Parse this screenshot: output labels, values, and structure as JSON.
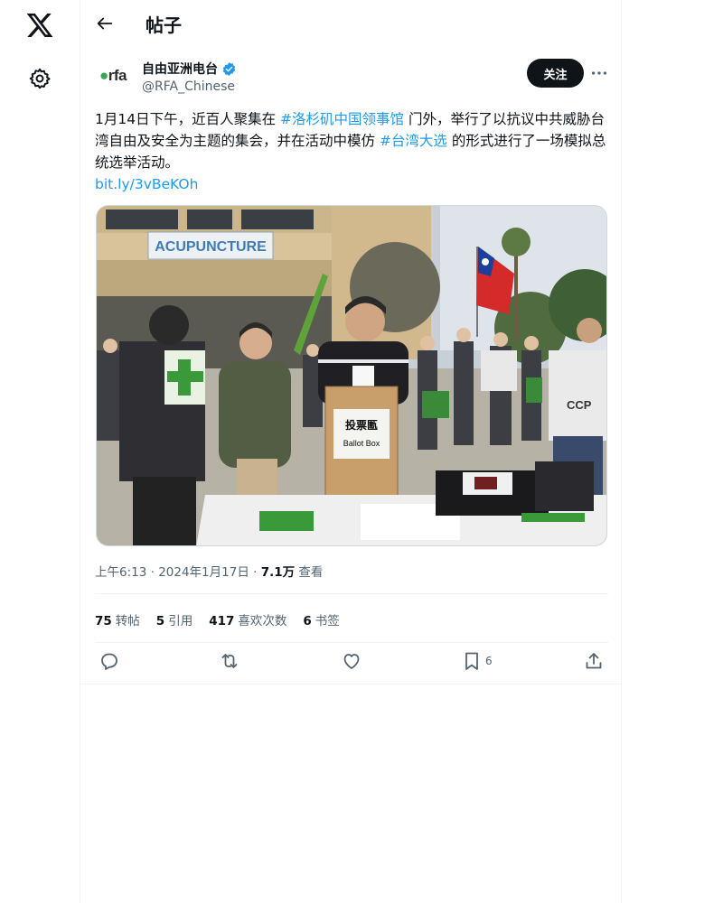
{
  "app": {
    "logo": "x-logo-icon",
    "settings_icon": "gear-icon"
  },
  "header": {
    "back_icon": "arrow-left-icon",
    "title": "帖子"
  },
  "author": {
    "avatar_logo": "rfa",
    "display_name": "自由亚洲电台",
    "verified_icon": "verified-badge-icon",
    "handle": "@RFA_Chinese",
    "follow_label": "关注",
    "more_icon": "more-horizontal-icon"
  },
  "tweet": {
    "text_parts": {
      "p1": "1月14日下午，近百人聚集在 ",
      "tag1": "#洛杉矶中国领事馆",
      "p2": " 门外，举行了以抗议中共威胁台湾自由及安全为主题的集会，并在活动中模仿 ",
      "tag2": "#台湾大选",
      "p3": " 的形式进行了一场模拟总统选举活动。"
    },
    "link": "bit.ly/3vBeKOh",
    "media": {
      "building_sign": "ACUPUNCTURE",
      "ballot_box_label_cn": "投票匭",
      "ballot_box_label_en": "Ballot Box",
      "shirt_text": "CCP"
    },
    "time": "上午6:13",
    "sep": " · ",
    "date": "2024年1月17日",
    "views_count": "7.1万",
    "views_label": " 查看"
  },
  "stats": [
    {
      "count": "75",
      "label": "转帖"
    },
    {
      "count": "5",
      "label": "引用"
    },
    {
      "count": "417",
      "label": "喜欢次数"
    },
    {
      "count": "6",
      "label": "书签"
    }
  ],
  "actions": {
    "reply_icon": "reply-icon",
    "retweet_icon": "retweet-icon",
    "like_icon": "heart-icon",
    "bookmark_icon": "bookmark-icon",
    "bookmark_count": "6",
    "share_icon": "share-icon"
  },
  "colors": {
    "accent": "#1d9bf0",
    "text": "#0f1419",
    "muted": "#536471",
    "border": "#eff3f4"
  }
}
